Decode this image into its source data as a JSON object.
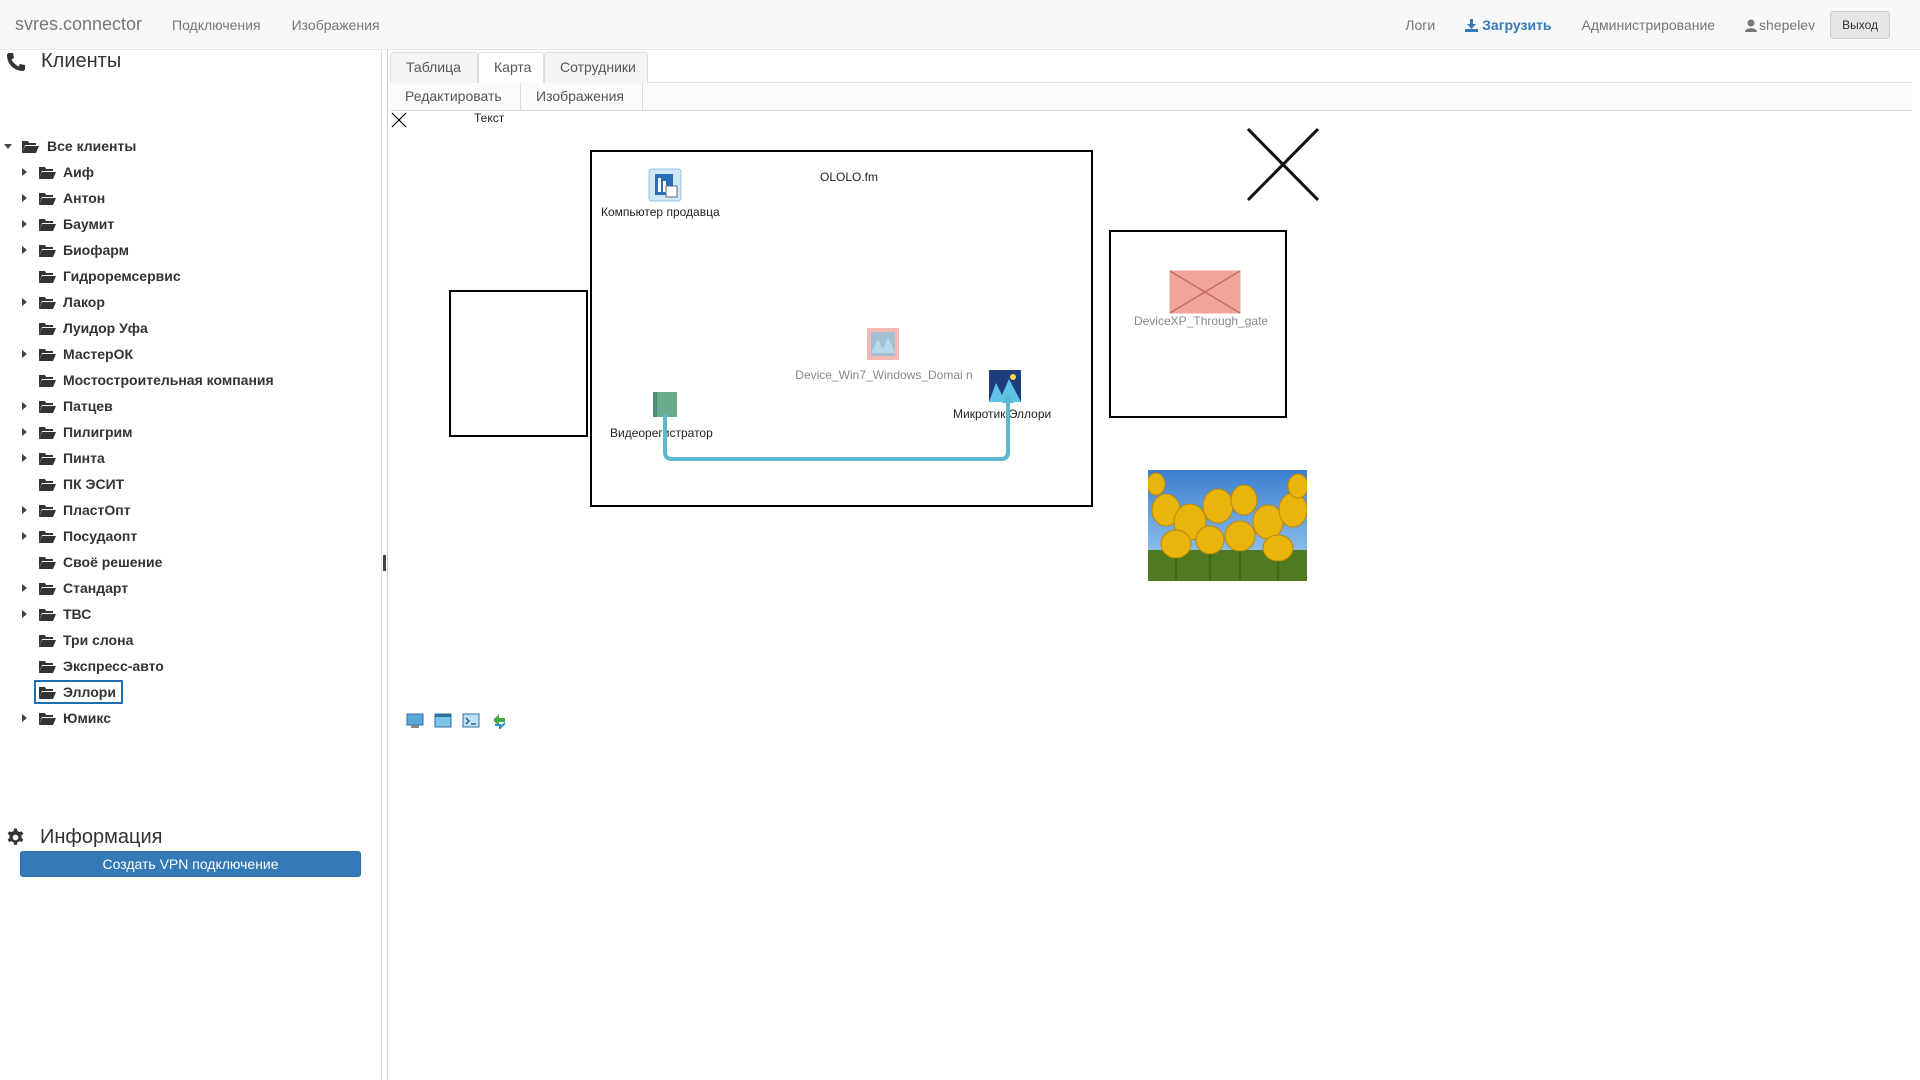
{
  "navbar": {
    "brand": "svres.connector",
    "left_links": [
      "Подключения",
      "Изображения"
    ],
    "logs": "Логи",
    "upload": "Загрузить",
    "admin": "Администрирование",
    "user": "shepelev",
    "logout": "Выход"
  },
  "sidebar": {
    "clients_title": "Клиенты",
    "root": "Все клиенты",
    "clients": [
      {
        "label": "Аиф",
        "expandable": true
      },
      {
        "label": "Антон",
        "expandable": true
      },
      {
        "label": "Баумит",
        "expandable": true
      },
      {
        "label": "Биофарм",
        "expandable": true
      },
      {
        "label": "Гидроремсервис",
        "expandable": false
      },
      {
        "label": "Лакор",
        "expandable": true
      },
      {
        "label": "Луидор Уфа",
        "expandable": false
      },
      {
        "label": "МастерОК",
        "expandable": true
      },
      {
        "label": "Мостостроительная компания",
        "expandable": false
      },
      {
        "label": "Патцев",
        "expandable": true
      },
      {
        "label": "Пилигрим",
        "expandable": true
      },
      {
        "label": "Пинта",
        "expandable": true
      },
      {
        "label": "ПК ЭСИТ",
        "expandable": false
      },
      {
        "label": "ПластОпт",
        "expandable": true
      },
      {
        "label": "Посудаопт",
        "expandable": true
      },
      {
        "label": "Своё решение",
        "expandable": false
      },
      {
        "label": "Стандарт",
        "expandable": true
      },
      {
        "label": "ТВС",
        "expandable": true
      },
      {
        "label": "Три слона",
        "expandable": false
      },
      {
        "label": "Экспресс-авто",
        "expandable": false
      },
      {
        "label": "Эллори",
        "expandable": false,
        "selected": true
      },
      {
        "label": "Юмикс",
        "expandable": true
      }
    ],
    "info_title": "Информация",
    "vpn_button": "Создать VPN подключение"
  },
  "tabs": [
    "Таблица",
    "Карта",
    "Сотрудники"
  ],
  "active_tab": "Карта",
  "subtabs": [
    "Редактировать",
    "Изображения"
  ],
  "map": {
    "text_label": "Текст",
    "group_label": "OLOLO.fm",
    "devices": {
      "seller_pc": "Компьютер продавца",
      "video_recorder": "Видеорегистратор",
      "mikrotik": "Микротик Эллори",
      "win7": "Device_Win7_Windows_Domai n",
      "xp_gate": "DeviceXP_Through_gate"
    },
    "connection_color": "#5bb8cf"
  },
  "toolbar_icons": [
    "monitor-icon",
    "window-icon",
    "terminal-icon",
    "sync-icon"
  ]
}
